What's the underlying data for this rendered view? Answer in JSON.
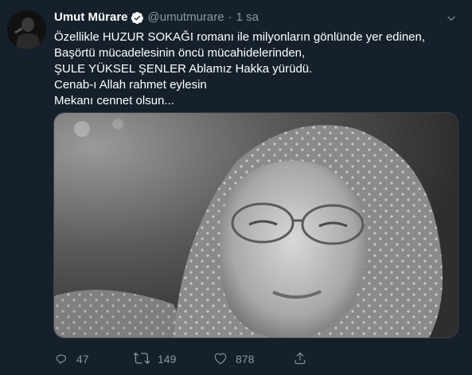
{
  "tweet": {
    "author_name": "Umut Mürare",
    "handle": "@umutmurare",
    "separator": "·",
    "time": "1 sa",
    "text_lines": [
      "Özellikle HUZUR SOKAĞI romanı ile milyonların gönlünde yer edinen,",
      "Başörtü mücadelesinin öncü mücahidelerinden,",
      "ŞULE YÜKSEL ŞENLER Ablamız Hakka yürüdü.",
      "Cenab-ı Allah rahmet eylesin",
      "Mekanı cennet olsun..."
    ],
    "verified_icon": "verified-badge-icon",
    "menu_icon": "chevron-down-icon"
  },
  "actions": {
    "reply_count": "47",
    "retweet_count": "149",
    "like_count": "878"
  },
  "colors": {
    "background": "#15202b",
    "text": "#ffffff",
    "muted": "#8899a6"
  }
}
